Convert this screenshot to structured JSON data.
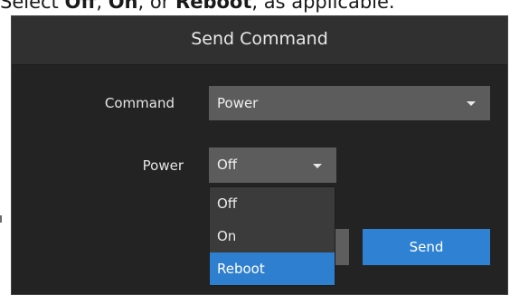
{
  "instruction": {
    "prefix": "Select ",
    "opt1": "Off",
    "sep1": ", ",
    "opt2": "On",
    "sep2": ", or ",
    "opt3": "Reboot",
    "suffix": ", as applicable."
  },
  "dialog": {
    "title": "Send Command",
    "command_label": "Command",
    "command_value": "Power",
    "power_label": "Power",
    "power_value": "Off",
    "send_label": "Send"
  },
  "power_menu": {
    "options": [
      "Off",
      "On",
      "Reboot"
    ],
    "highlighted": "Reboot"
  },
  "colors": {
    "dialog_bg": "#232323",
    "header_bg": "#303030",
    "select_bg": "#5c5c5c",
    "accent": "#2f82d3"
  }
}
